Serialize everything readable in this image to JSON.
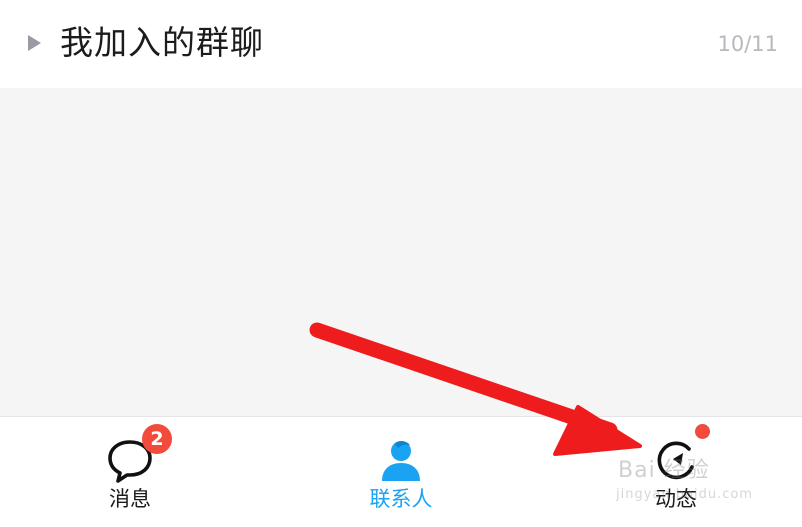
{
  "group": {
    "title": "我加入的群聊",
    "count": "10/11"
  },
  "tabs": [
    {
      "label": "消息",
      "icon": "chat-bubble-icon",
      "badge": "2",
      "active": false
    },
    {
      "label": "联系人",
      "icon": "contacts-person-icon",
      "active": true
    },
    {
      "label": "动态",
      "icon": "moments-refresh-icon",
      "has_dot": true,
      "active": false
    }
  ],
  "watermark": {
    "text": "Bai 经验",
    "sub": "jingyan.baidu.com"
  },
  "colors": {
    "active_tab": "#1aa3f2",
    "badge": "#f24b3c",
    "annotation_arrow": "#ee1c1c"
  }
}
